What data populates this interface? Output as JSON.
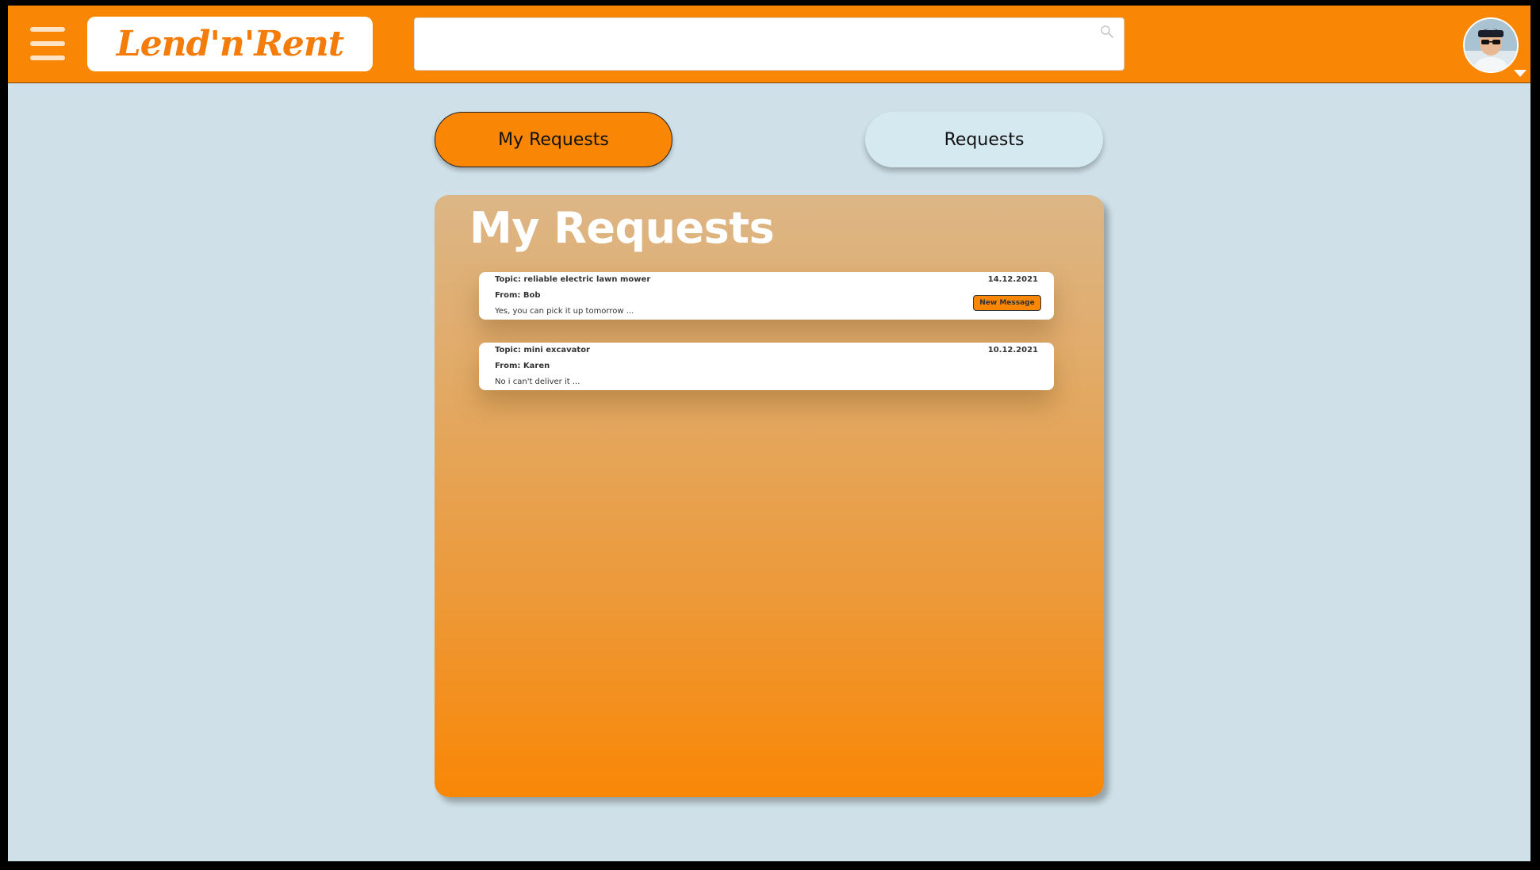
{
  "header": {
    "menu_icon": "hamburger-icon",
    "logo_text": "Lend'n'Rent",
    "search": {
      "value": "",
      "placeholder": "",
      "icon": "search-icon"
    },
    "avatar_icon": "user-avatar",
    "dropdown_icon": "caret-down-icon"
  },
  "tabs": [
    {
      "label": "My Requests",
      "active": true
    },
    {
      "label": "Requests",
      "active": false
    }
  ],
  "panel": {
    "title": "My Requests",
    "messages": [
      {
        "topic": "Topic: reliable electric lawn mower",
        "from": "From: Bob",
        "preview": "Yes, you can pick it up tomorrow ...",
        "date": "14.12.2021",
        "badge": "New Message"
      },
      {
        "topic": "Topic: mini excavator",
        "from": "From: Karen",
        "preview": "No i can't deliver it ...",
        "date": "10.12.2021",
        "badge": ""
      }
    ]
  },
  "colors": {
    "brand_orange": "#f98705",
    "background": "#cfe0e8",
    "inactive_tab": "#d5e9f1",
    "logo_text": "#f47c0a"
  }
}
